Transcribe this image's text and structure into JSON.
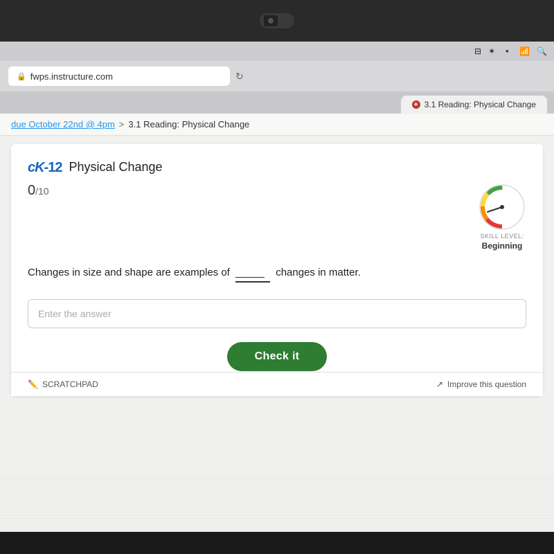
{
  "laptop": {
    "webcam_alt": "webcam"
  },
  "menubar": {
    "icons": [
      "⊟",
      "✶",
      "🔋",
      "wifi",
      "🔍"
    ]
  },
  "browser": {
    "address": "fwps.instructure.com",
    "refresh_label": "↻",
    "tab_label": "3.1 Reading: Physical Change"
  },
  "breadcrumb": {
    "parent_label": "due October 22nd @ 4pm",
    "separator": ">",
    "current_label": "3.1 Reading: Physical Change"
  },
  "ck12": {
    "logo": "cK-12",
    "title": "Physical Change",
    "score": "0",
    "score_denominator": "/10",
    "skill_level_label": "SKILL LEVEL:",
    "skill_level_value": "Beginning"
  },
  "question": {
    "text_before": "Changes in size and shape are examples of",
    "blank": "_____",
    "text_after": "changes in matter."
  },
  "input": {
    "placeholder": "Enter the answer"
  },
  "buttons": {
    "check_it": "Check it",
    "scratchpad": "SCRATCHPAD",
    "improve": "Improve this question"
  }
}
